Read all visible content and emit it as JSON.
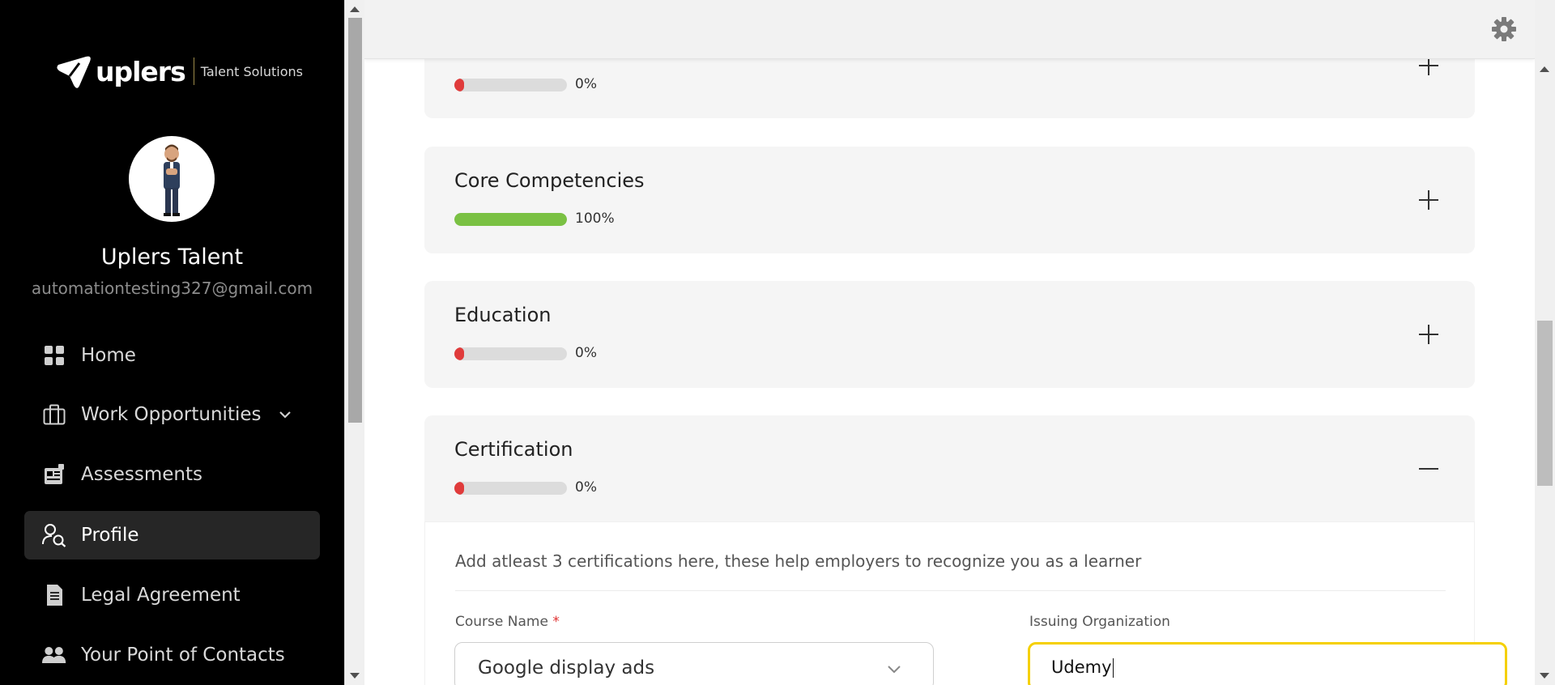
{
  "brand": {
    "name": "uplers",
    "tagline": "Talent Solutions"
  },
  "user": {
    "name": "Uplers Talent",
    "email": "automationtesting327@gmail.com"
  },
  "nav": {
    "items": [
      {
        "label": "Home",
        "icon": "grid-icon"
      },
      {
        "label": "Work Opportunities",
        "icon": "briefcase-icon",
        "has_dropdown": true
      },
      {
        "label": "Assessments",
        "icon": "assessment-icon"
      },
      {
        "label": "Profile",
        "icon": "profile-search-icon",
        "active": true
      },
      {
        "label": "Legal Agreement",
        "icon": "document-icon"
      },
      {
        "label": "Your Point of Contacts",
        "icon": "contacts-icon"
      }
    ]
  },
  "sections": {
    "partial": {
      "title": "",
      "percent_label": "0%",
      "percent": 0,
      "toggle": "plus"
    },
    "core": {
      "title": "Core Competencies",
      "percent_label": "100%",
      "percent": 100,
      "toggle": "plus"
    },
    "education": {
      "title": "Education",
      "percent_label": "0%",
      "percent": 0,
      "toggle": "plus"
    },
    "certification": {
      "title": "Certification",
      "percent_label": "0%",
      "percent": 0,
      "toggle": "minus"
    }
  },
  "certification_form": {
    "hint": "Add atleast 3 certifications here, these help employers to recognize you as a learner",
    "course_label": "Course Name",
    "course_required_mark": "*",
    "course_value": "Google display ads",
    "org_label": "Issuing Organization",
    "org_value": "Udemy"
  },
  "colors": {
    "sidebar_bg": "#000000",
    "progress_complete": "#7ac143",
    "progress_empty": "#e03b3b",
    "focus_border": "#f5d000"
  }
}
